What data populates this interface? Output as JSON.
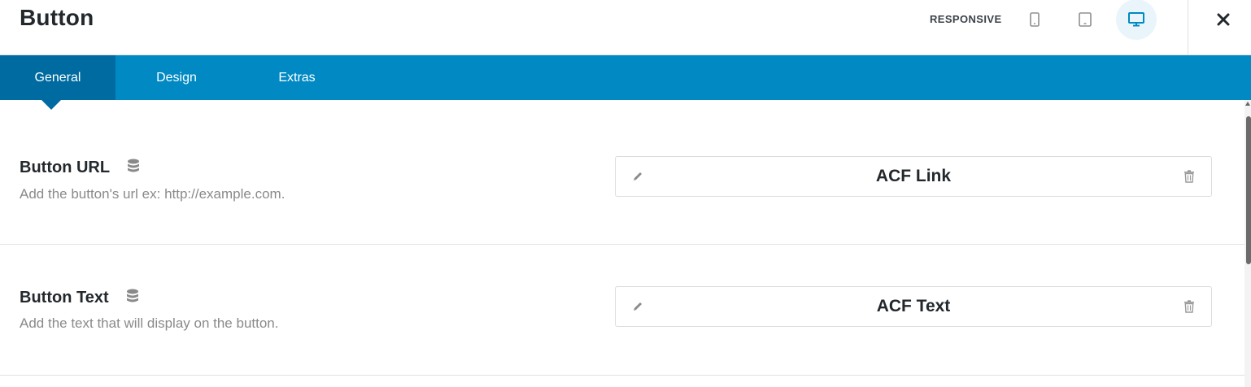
{
  "header": {
    "title": "Button",
    "responsive_label": "RESPONSIVE",
    "devices": [
      {
        "name": "mobile",
        "icon": "mobile-icon",
        "active": false
      },
      {
        "name": "tablet",
        "icon": "tablet-icon",
        "active": false
      },
      {
        "name": "desktop",
        "icon": "desktop-icon",
        "active": true
      }
    ],
    "close_icon": "close-icon"
  },
  "tabs": [
    {
      "label": "General",
      "active": true
    },
    {
      "label": "Design",
      "active": false
    },
    {
      "label": "Extras",
      "active": false
    }
  ],
  "fields": [
    {
      "label": "Button URL",
      "icon": "database-icon",
      "description": "Add the button's url ex: http://example.com.",
      "connection": {
        "label": "ACF Link",
        "edit_icon": "pencil-icon",
        "remove_icon": "trash-icon"
      }
    },
    {
      "label": "Button Text",
      "icon": "database-icon",
      "description": "Add the text that will display on the button.",
      "connection": {
        "label": "ACF Text",
        "edit_icon": "pencil-icon",
        "remove_icon": "trash-icon"
      }
    }
  ],
  "colors": {
    "tab_bar": "#0089c3",
    "tab_active": "#006ba0",
    "device_active": "#0089c3",
    "description": "#8a8a8a"
  }
}
